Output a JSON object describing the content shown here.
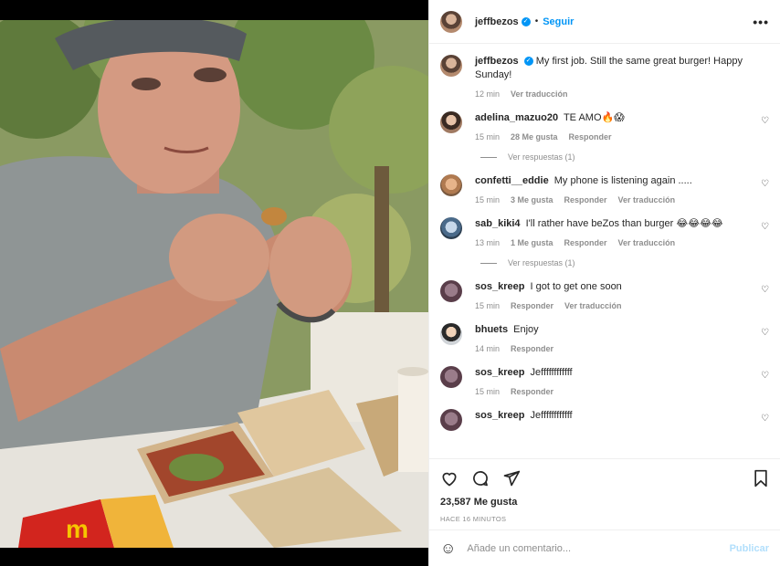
{
  "post": {
    "author": "jeffbezos",
    "follow_label": "Seguir",
    "more_label": "•••",
    "dot": "•",
    "verified_mark": "✓"
  },
  "caption": {
    "author": "jeffbezos",
    "text": "My first job. Still the same great burger! Happy Sunday!",
    "time": "12 min",
    "translate": "Ver traducción"
  },
  "comments": [
    {
      "user": "adelina_mazuo20",
      "text": "TE AMO🔥😱",
      "time": "15 min",
      "likes": "28 Me gusta",
      "reply": "Responder",
      "translate": "",
      "replies": "Ver respuestas (1)"
    },
    {
      "user": "confetti__eddie",
      "text": "My phone is listening again .....",
      "time": "15 min",
      "likes": "3 Me gusta",
      "reply": "Responder",
      "translate": "Ver traducción",
      "replies": ""
    },
    {
      "user": "sab_kiki4",
      "text": "I'll rather have beZos than burger 😂😂😂😂",
      "time": "13 min",
      "likes": "1 Me gusta",
      "reply": "Responder",
      "translate": "Ver traducción",
      "replies": "Ver respuestas (1)"
    },
    {
      "user": "sos_kreep",
      "text": "I got to get one soon",
      "time": "15 min",
      "likes": "",
      "reply": "Responder",
      "translate": "Ver traducción",
      "replies": ""
    },
    {
      "user": "bhuets",
      "text": "Enjoy",
      "time": "14 min",
      "likes": "",
      "reply": "Responder",
      "translate": "",
      "replies": ""
    },
    {
      "user": "sos_kreep",
      "text": "Jeffffffffffff",
      "time": "15 min",
      "likes": "",
      "reply": "Responder",
      "translate": "",
      "replies": ""
    },
    {
      "user": "sos_kreep",
      "text": "Jeffffffffffff",
      "time": "",
      "likes": "",
      "reply": "",
      "translate": "",
      "replies": ""
    }
  ],
  "likes_count": "23,587 Me gusta",
  "time_ago": "HACE 16 MINUTOS",
  "add_comment": {
    "placeholder": "Añade un comentario...",
    "publish": "Publicar",
    "emoji": "☺"
  },
  "icons": {
    "like": "heart-icon",
    "comment": "comment-icon",
    "share": "share-icon",
    "save": "bookmark-icon",
    "comment_like": "small-heart-icon"
  },
  "colors": {
    "accent": "#0095f6",
    "publish_disabled": "#b2dffc",
    "muted": "#8e8e8e"
  }
}
